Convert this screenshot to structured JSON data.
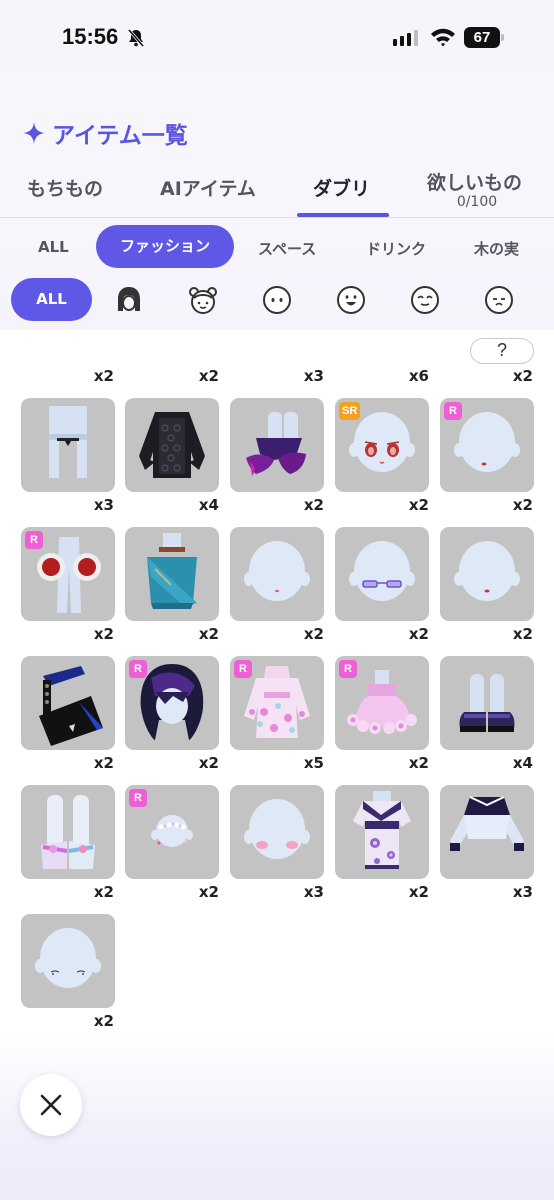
{
  "status": {
    "time": "15:56",
    "battery": "67"
  },
  "title": "アイテム一覧",
  "main_tabs": [
    {
      "label": "もちもの"
    },
    {
      "label": "AIアイテム"
    },
    {
      "label": "ダブリ",
      "active": true
    },
    {
      "label": "欲しいもの",
      "sub": "0/100"
    }
  ],
  "categories": [
    "ALL",
    "ファッション",
    "スペース",
    "ドリンク",
    "木の実"
  ],
  "active_category": "ファッション",
  "sub_filter": {
    "all_label": "ALL",
    "icons": [
      "hair-icon",
      "face-bun-icon",
      "face-neutral-icon",
      "face-smile-icon",
      "face-closed-eyes-icon",
      "face-shy-icon"
    ]
  },
  "help_label": "?",
  "top_counts": [
    "x2",
    "x2",
    "x3",
    "x6",
    "x2"
  ],
  "items": [
    {
      "name": "tall-white-hat-with-choker",
      "count": "x3",
      "badge": ""
    },
    {
      "name": "black-lace-blouse",
      "count": "x4",
      "badge": ""
    },
    {
      "name": "purple-flame-boots",
      "count": "x2",
      "badge": ""
    },
    {
      "name": "red-eyes-face",
      "count": "x2",
      "badge": "SR"
    },
    {
      "name": "small-red-mouth-face",
      "count": "x2",
      "badge": "R"
    },
    {
      "name": "red-white-pompom-earmuffs",
      "count": "x2",
      "badge": "R"
    },
    {
      "name": "teal-wrap-top",
      "count": "x2",
      "badge": ""
    },
    {
      "name": "plain-face-pink-mouth",
      "count": "x2",
      "badge": ""
    },
    {
      "name": "purple-glasses",
      "count": "x2",
      "badge": ""
    },
    {
      "name": "plain-face-red-lips",
      "count": "x2",
      "badge": ""
    },
    {
      "name": "black-blue-shoulder-bag",
      "count": "x2",
      "badge": ""
    },
    {
      "name": "dark-purple-wolf-hair",
      "count": "x2",
      "badge": "R"
    },
    {
      "name": "pink-floral-dress",
      "count": "x5",
      "badge": "R"
    },
    {
      "name": "pink-flower-ruffle-skirt",
      "count": "x2",
      "badge": "R"
    },
    {
      "name": "purple-short-boots",
      "count": "x4",
      "badge": ""
    },
    {
      "name": "iridescent-sandals",
      "count": "x2",
      "badge": ""
    },
    {
      "name": "flower-crown-face",
      "count": "x2",
      "badge": "R"
    },
    {
      "name": "blush-cheeks-face",
      "count": "x3",
      "badge": ""
    },
    {
      "name": "purple-floral-kimono",
      "count": "x2",
      "badge": ""
    },
    {
      "name": "navy-shoulder-top",
      "count": "x3",
      "badge": ""
    },
    {
      "name": "sleepy-eyes-face",
      "count": "x2",
      "badge": ""
    }
  ],
  "colors": {
    "accent": "#5f58e6",
    "tile_bg": "#c3c3c3",
    "badge_r": "#ee5fd6",
    "badge_sr": "#f3a11e"
  }
}
